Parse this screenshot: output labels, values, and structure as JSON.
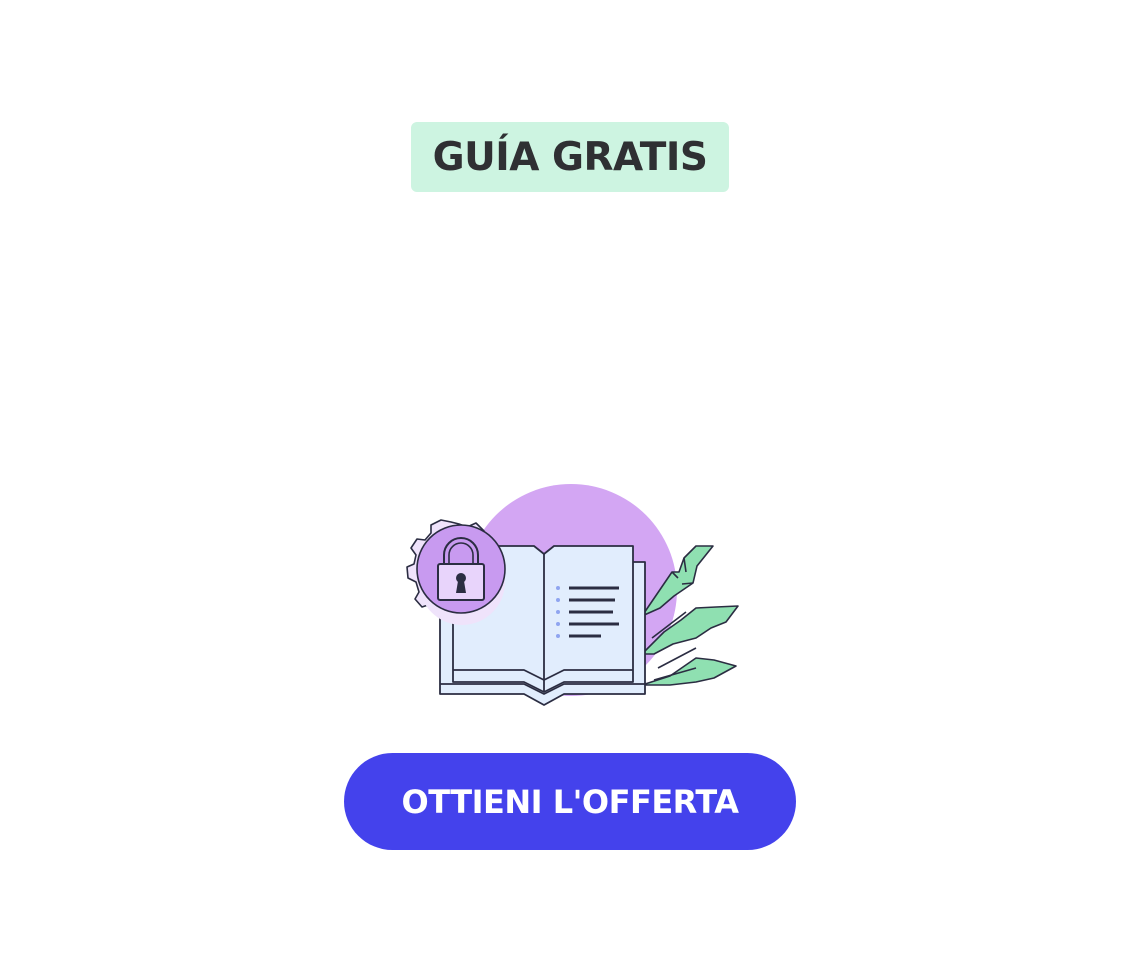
{
  "badge": {
    "label": "GUÍA GRATIS",
    "background_color": "#cdf4e1",
    "text_color": "#2f3033"
  },
  "illustration": {
    "icons": [
      "gear-lock-icon",
      "open-book-icon",
      "leaves-icon",
      "purple-circle-backdrop"
    ],
    "colors": {
      "purple": "#d3a6f3",
      "book_fill": "#e1edfd",
      "leaf_green": "#8fe0b1",
      "outline": "#2b2d42",
      "dots": "#8fa5f0"
    }
  },
  "cta": {
    "label": "OTTIENI L'OFFERTA",
    "background_color": "#4442ec",
    "text_color": "#ffffff"
  }
}
